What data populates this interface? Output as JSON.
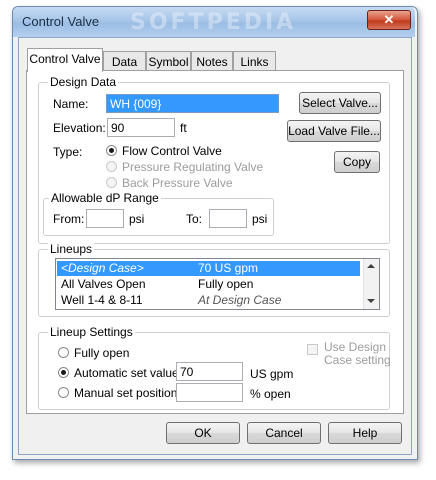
{
  "window": {
    "title": "Control Valve",
    "watermark": "SOFTPEDIA",
    "close_glyph": "✕"
  },
  "tabs": [
    "Control Valve",
    "Data",
    "Symbol",
    "Notes",
    "Links"
  ],
  "design_data": {
    "legend": "Design Data",
    "name_label": "Name:",
    "name_value": "WH {009}",
    "elevation_label": "Elevation:",
    "elevation_value": "90",
    "elevation_unit": "ft",
    "type_label": "Type:",
    "types": [
      {
        "label": "Flow Control Valve",
        "selected": true,
        "enabled": true
      },
      {
        "label": "Pressure Regulating Valve",
        "selected": false,
        "enabled": false
      },
      {
        "label": "Back Pressure Valve",
        "selected": false,
        "enabled": false
      }
    ],
    "select_valve_button": "Select Valve...",
    "load_valve_file_button": "Load Valve File...",
    "copy_button": "Copy"
  },
  "dp_range": {
    "legend": "Allowable dP Range",
    "from_label": "From:",
    "from_value": "",
    "from_unit": "psi",
    "to_label": "To:",
    "to_value": "",
    "to_unit": "psi"
  },
  "lineups": {
    "legend": "Lineups",
    "rows": [
      {
        "name": "<Design Case>",
        "value": "70 US gpm",
        "selected": true
      },
      {
        "name": "All Valves Open",
        "value": "Fully open",
        "selected": false
      },
      {
        "name": "Well 1-4 & 8-11",
        "value": "At Design Case",
        "selected": false
      }
    ]
  },
  "lineup_settings": {
    "legend": "Lineup Settings",
    "options": [
      {
        "label": "Fully open",
        "selected": false
      },
      {
        "label": "Automatic set value",
        "selected": true
      },
      {
        "label": "Manual set position",
        "selected": false
      }
    ],
    "auto_value": "70",
    "auto_unit": "US gpm",
    "manual_value": "",
    "manual_unit": "% open",
    "use_design_label_line1": "Use Design",
    "use_design_label_line2": "Case setting"
  },
  "footer": {
    "ok": "OK",
    "cancel": "Cancel",
    "help": "Help"
  }
}
